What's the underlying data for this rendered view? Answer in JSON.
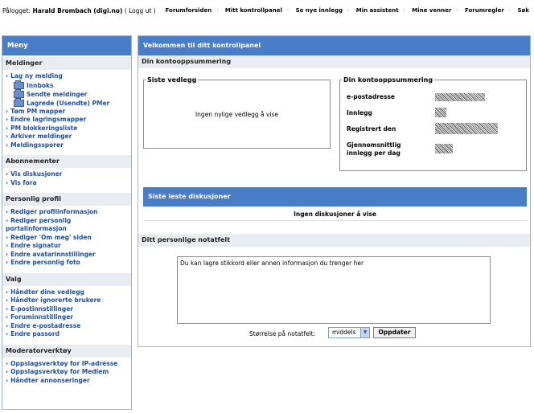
{
  "topbar": {
    "logged_in_label": "Pålogget:",
    "user": "Harald Brombach (digi.no)",
    "logout": "( Logg ut )",
    "nav": [
      "Forumforsiden",
      "Mitt kontrollpanel",
      "Se nye innlegg",
      "Min assistent",
      "Mine venner",
      "Forumregler",
      "Søk"
    ]
  },
  "sidebar": {
    "title": "Meny",
    "sections": {
      "meldinger": {
        "heading": "Meldinger",
        "new_message": "Lag ny melding",
        "inbox": "Innboks",
        "sent": "Sendte meldinger",
        "saved": "Lagrede (Usendte) PMer",
        "empty_folders": "Tøm PM mapper",
        "change_folders": "Endre lagringsmapper",
        "blocklist": "PM blokkeringsliste",
        "archive": "Arkiver meldinger",
        "tracker": "Meldingssporer"
      },
      "abonnementer": {
        "heading": "Abonnementer",
        "items": [
          "Vis diskusjoner",
          "Vis fora"
        ]
      },
      "profil": {
        "heading": "Personlig profil",
        "items": [
          "Rediger profilinformasjon",
          "Rediger personlig portalinformasjon",
          "Rediger 'Om meg' siden",
          "Endre signatur",
          "Endre avatarinnstillinger",
          "Endre personlig foto"
        ]
      },
      "valg": {
        "heading": "Valg",
        "items": [
          "Håndter dine vedlegg",
          "Håndter ignorerte brukere",
          "E-postinnstillinger",
          "Foruminnstillinger",
          "Endre e-postadresse",
          "Endre passord"
        ]
      },
      "moderator": {
        "heading": "Moderatorverktøy",
        "items": [
          "Oppslagsverktøy for IP-adresse",
          "Oppslagsverktøy for Medlem",
          "Håndter annonseringer"
        ]
      }
    }
  },
  "main": {
    "title": "Velkommen til ditt kontrollpanel",
    "summary_heading": "Din kontooppsummering",
    "attachments": {
      "legend": "Siste vedlegg",
      "empty": "Ingen nylige vedlegg å vise"
    },
    "account": {
      "legend": "Din kontooppsummering",
      "email_label": "e-postadresse",
      "posts_label": "Innlegg",
      "registered_label": "Registrert den",
      "average_label_1": "Gjennomsnittlig",
      "average_label_2": "innlegg per dag"
    },
    "recent": {
      "heading": "Siste leste diskusjoner",
      "empty": "Ingen diskusjoner å vise"
    },
    "notes": {
      "heading": "Ditt personlige notatfelt",
      "text": "Du kan lagre stikkord eller annen informasjon du trenger her",
      "size_label": "Størrelse på notatfelt:",
      "size_value": "middels",
      "update_button": "Oppdater"
    }
  }
}
